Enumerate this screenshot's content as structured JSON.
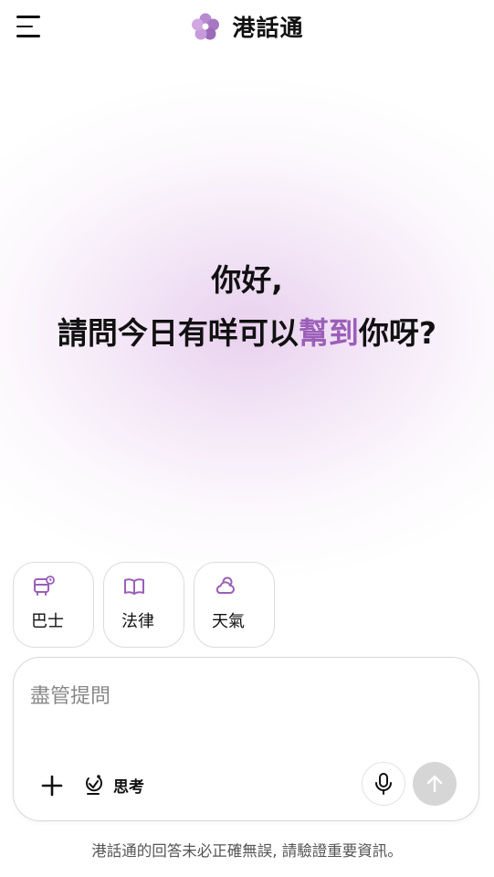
{
  "header": {
    "app_name": "港話通",
    "menu_icon": "menu-icon",
    "logo_icon": "flower-logo-icon"
  },
  "greeting": {
    "line1": "你好,",
    "line2_before": "請問今日有咩可以",
    "line2_highlight": "幫到",
    "line2_after": "你呀?"
  },
  "chips": [
    {
      "label": "巴士",
      "icon": "bus-icon"
    },
    {
      "label": "法律",
      "icon": "book-icon"
    },
    {
      "label": "天氣",
      "icon": "weather-icon"
    }
  ],
  "input": {
    "placeholder": "盡管提問",
    "value": "",
    "add_icon": "plus-icon",
    "think_label": "思考",
    "think_icon": "think-icon",
    "mic_icon": "microphone-icon",
    "send_icon": "send-arrow-icon"
  },
  "disclaimer": "港話通的回答未必正確無誤, 請驗證重要資訊。",
  "colors": {
    "accent": "#9b5fb8",
    "glow": "#c992d6",
    "send_disabled": "#d6d6d6"
  }
}
